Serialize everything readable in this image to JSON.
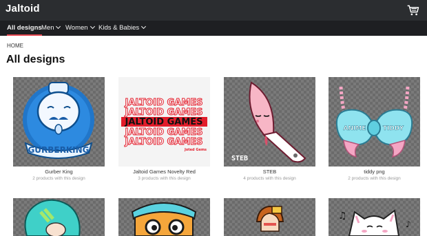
{
  "header": {
    "brand": "Jaltoid",
    "cart_icon": "cart-icon"
  },
  "nav": {
    "items": [
      {
        "label": "All designs",
        "active": true,
        "dropdown": false
      },
      {
        "label": "Men",
        "active": false,
        "dropdown": true
      },
      {
        "label": "Women",
        "active": false,
        "dropdown": true
      },
      {
        "label": "Kids & Babies",
        "active": false,
        "dropdown": true
      }
    ],
    "accent": "#e5464f"
  },
  "breadcrumb": "HOME",
  "page_title": "All designs",
  "designs": [
    {
      "name": "Gurber King",
      "count": "2 products with this design",
      "art_text": "GURBERKING"
    },
    {
      "name": "Jaltoid Games Novelty Red",
      "count": "3 products with this design",
      "art_text": "JALTOID GAMES",
      "art_sub": "Joted Gems"
    },
    {
      "name": "STEB",
      "count": "4 products with this design",
      "art_text": "STEB"
    },
    {
      "name": "tiddy png",
      "count": "2 products with this design",
      "art_left": "ANIME",
      "art_right": "TIDDY"
    },
    {
      "name": "",
      "count": ""
    },
    {
      "name": "",
      "count": ""
    },
    {
      "name": "",
      "count": ""
    },
    {
      "name": "",
      "count": ""
    }
  ]
}
